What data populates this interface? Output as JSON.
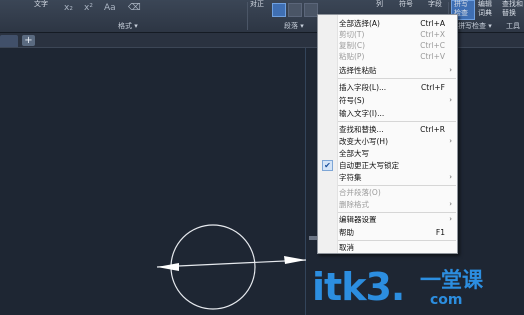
{
  "ribbon": {
    "font_label": "文字",
    "format_title": "格式 ▾",
    "paragraph_title": "段落 ▾",
    "spellcheck_title": "拼写检查 ▾",
    "tools_title": "工具",
    "columns_label": "列",
    "align_label": "对正",
    "symbol_label": "符号",
    "field_label": "字段",
    "check_label_1": "拼写",
    "check_label_2": "检查",
    "dict_label_1": "编辑",
    "dict_label_2": "词典",
    "find_label_1": "查找和",
    "find_label_2": "替换"
  },
  "tabs": {
    "add_label": "+"
  },
  "menu": {
    "items": [
      {
        "label": "全部选择(A)",
        "shortcut": "Ctrl+A",
        "disabled": false
      },
      {
        "label": "剪切(T)",
        "shortcut": "Ctrl+X",
        "disabled": true
      },
      {
        "label": "复制(C)",
        "shortcut": "Ctrl+C",
        "disabled": true
      },
      {
        "label": "粘贴(P)",
        "shortcut": "Ctrl+V",
        "disabled": true
      },
      {
        "label": "选择性粘贴",
        "submenu": true
      },
      {
        "label": "插入字段(L)...",
        "shortcut": "Ctrl+F"
      },
      {
        "label": "符号(S)",
        "submenu": true
      },
      {
        "label": "输入文字(I)..."
      },
      {
        "label": "查找和替换...",
        "shortcut": "Ctrl+R"
      },
      {
        "label": "改变大小写(H)",
        "submenu": true
      },
      {
        "label": "全部大写"
      },
      {
        "label": "自动更正大写锁定",
        "checked": true
      },
      {
        "label": "字符集",
        "submenu": true
      },
      {
        "label": "合并段落(O)",
        "disabled": true
      },
      {
        "label": "删除格式",
        "disabled": true,
        "submenu": true
      },
      {
        "label": "编辑器设置",
        "submenu": true
      },
      {
        "label": "帮助",
        "shortcut": "F1"
      },
      {
        "label": "取消"
      }
    ],
    "arrow_glyph": "›",
    "check_glyph": "✔"
  },
  "watermark": {
    "domain": "itk3.",
    "com": "com",
    "brand": "一堂课"
  },
  "colors": {
    "background": "#1e2633",
    "menu_bg": "#fafafa",
    "watermark": "#2c8ee0",
    "accent": "#3f6fb3"
  }
}
